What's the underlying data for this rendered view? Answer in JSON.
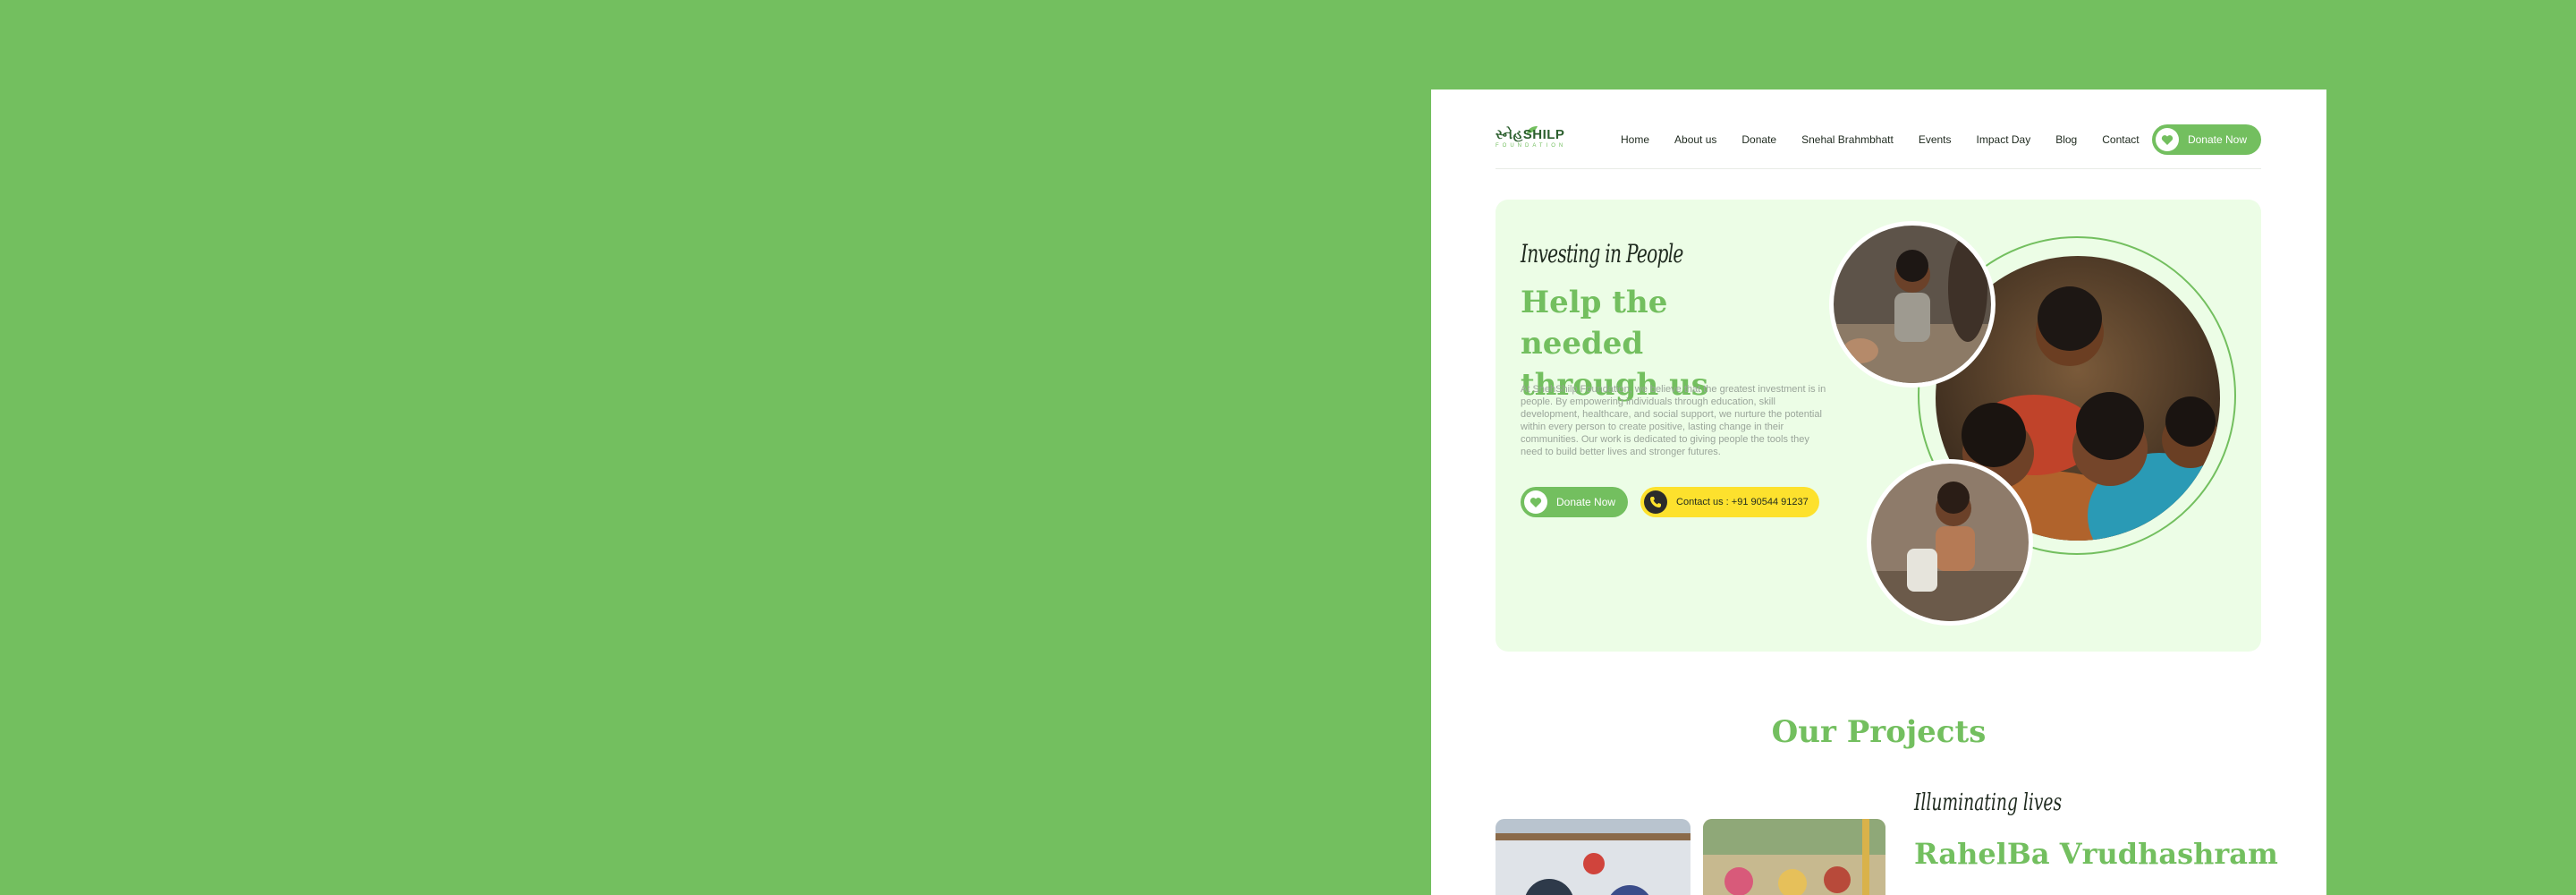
{
  "colors": {
    "brand_green": "#73bf5f",
    "hero_bg": "#ecfde6",
    "accent_yellow": "#fde12d",
    "dark_text": "#1f2a1f"
  },
  "header": {
    "logo": {
      "main": "સ્નેહSHILP",
      "sub": "FOUNDATION"
    },
    "nav": [
      "Home",
      "About us",
      "Donate",
      "Snehal Brahmbhatt",
      "Events",
      "Impact Day",
      "Blog",
      "Contact"
    ],
    "donate_label": "Donate Now",
    "donate_icon": "heart-icon"
  },
  "hero": {
    "eyebrow": "Investing in People",
    "title": "Help the needed through us",
    "body": "At SnehShilp Foundation, we believe that the greatest investment is in people. By empowering individuals through education, skill development, healthcare, and social support, we nurture the potential within every person to create positive, lasting change in their communities. Our work is dedicated to giving people the tools they need to build better lives and stronger futures.",
    "donate_label": "Donate Now",
    "contact_label": "Contact us : +91 90544 91237",
    "contact_icon": "phone-icon"
  },
  "projects": {
    "title": "Our Projects",
    "eyebrow": "Illuminating lives",
    "name": "RahelBa Vrudhashram"
  }
}
